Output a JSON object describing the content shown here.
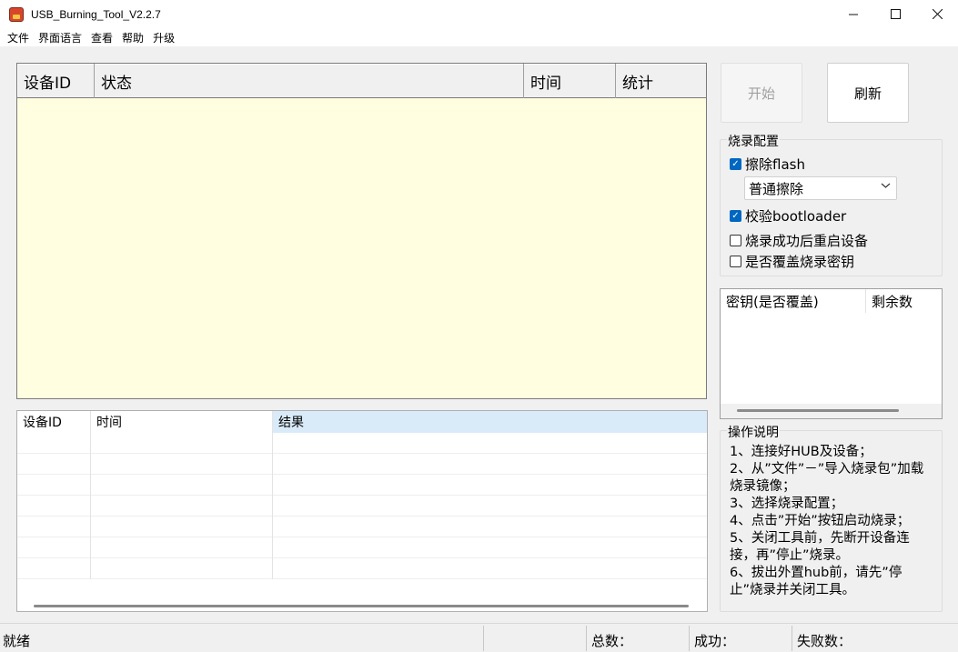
{
  "window": {
    "title": "USB_Burning_Tool_V2.2.7",
    "controls": {
      "minimize": "—",
      "maximize": "☐",
      "close": "✕"
    }
  },
  "menu": [
    "文件",
    "界面语言",
    "查看",
    "帮助",
    "升级"
  ],
  "device_grid": {
    "columns": [
      "设备ID",
      "状态",
      "时间",
      "统计"
    ],
    "background_color": "#fffee0"
  },
  "result_grid": {
    "columns": [
      "设备ID",
      "时间",
      "结果"
    ],
    "selected_column": "结果",
    "empty_row_count": 7
  },
  "buttons": {
    "start": "开始",
    "refresh": "刷新"
  },
  "burn_config": {
    "legend": "烧录配置",
    "erase_flash": {
      "label": "擦除flash",
      "checked": true
    },
    "erase_mode": {
      "selected": "普通擦除"
    },
    "verify_bootloader": {
      "label": "校验bootloader",
      "checked": true
    },
    "reboot_after_success": {
      "label": "烧录成功后重启设备",
      "checked": false
    },
    "overwrite_keys": {
      "label": "是否覆盖烧录密钥",
      "checked": false
    }
  },
  "keys_list": {
    "columns": [
      "密钥(是否覆盖)",
      "剩余数"
    ]
  },
  "instructions": {
    "legend": "操作说明",
    "lines": [
      "1、连接好HUB及设备；",
      "2、从”文件”－”导入烧录包”加载烧录镜像；",
      "3、选择烧录配置；",
      "4、点击”开始”按钮启动烧录；",
      "5、关闭工具前，先断开设备连接，再”停止”烧录。",
      "6、拔出外置hub前，请先”停止”烧录并关闭工具。"
    ]
  },
  "status_bar": {
    "status": "就绪",
    "total_label": "总数：",
    "success_label": "成功：",
    "fail_label": "失败数："
  },
  "colors": {
    "accent": "#0067c0",
    "selected_header": "#d9ebf9"
  }
}
